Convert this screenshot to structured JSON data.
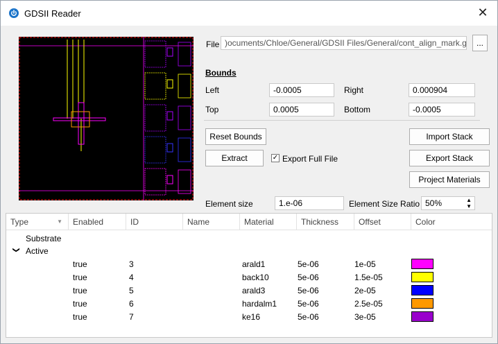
{
  "window": {
    "title": "GDSII Reader",
    "close_glyph": "✕",
    "icon": "power-icon",
    "accent": "#1a73c9"
  },
  "file": {
    "label": "File",
    "path": ")ocuments/Chloe/General/GDSII Files/General/cont_align_mark.gds",
    "browse_label": "..."
  },
  "bounds": {
    "heading": "Bounds",
    "left_label": "Left",
    "left_value": "-0.0005",
    "right_label": "Right",
    "right_value": "0.000904",
    "top_label": "Top",
    "top_value": "0.0005",
    "bottom_label": "Bottom",
    "bottom_value": "-0.0005"
  },
  "buttons": {
    "reset": "Reset Bounds",
    "import_stack": "Import Stack",
    "extract": "Extract",
    "export_stack": "Export Stack",
    "project_materials": "Project Materials"
  },
  "export_full": {
    "label": "Export Full File",
    "checked": true
  },
  "element": {
    "size_label": "Element size",
    "size_value": "1.e-06",
    "ratio_label": "Element Size Ratio",
    "ratio_value": "50%"
  },
  "table": {
    "columns": [
      "Type",
      "Enabled",
      "ID",
      "Name",
      "Material",
      "Thickness",
      "Offset",
      "Color"
    ],
    "groups": {
      "substrate": "Substrate",
      "active": "Active"
    },
    "rows": [
      {
        "enabled": "true",
        "id": "3",
        "material": "arald1",
        "thickness": "5e-06",
        "offset": "1e-05",
        "color": "#ff00ff"
      },
      {
        "enabled": "true",
        "id": "4",
        "material": "back10",
        "thickness": "5e-06",
        "offset": "1.5e-05",
        "color": "#ffff00"
      },
      {
        "enabled": "true",
        "id": "5",
        "material": "arald3",
        "thickness": "5e-06",
        "offset": "2e-05",
        "color": "#0000ff"
      },
      {
        "enabled": "true",
        "id": "6",
        "material": "hardalm1",
        "thickness": "5e-06",
        "offset": "2.5e-05",
        "color": "#ff9900"
      },
      {
        "enabled": "true",
        "id": "7",
        "material": "ke16",
        "thickness": "5e-06",
        "offset": "3e-05",
        "color": "#9900cc"
      }
    ]
  },
  "preview": {
    "colors": {
      "border": "#ff0000",
      "magenta": "#ff00ff",
      "yellow": "#ffff00",
      "blue": "#3333ff",
      "orange": "#ff9900",
      "purple": "#aa00ff"
    }
  }
}
